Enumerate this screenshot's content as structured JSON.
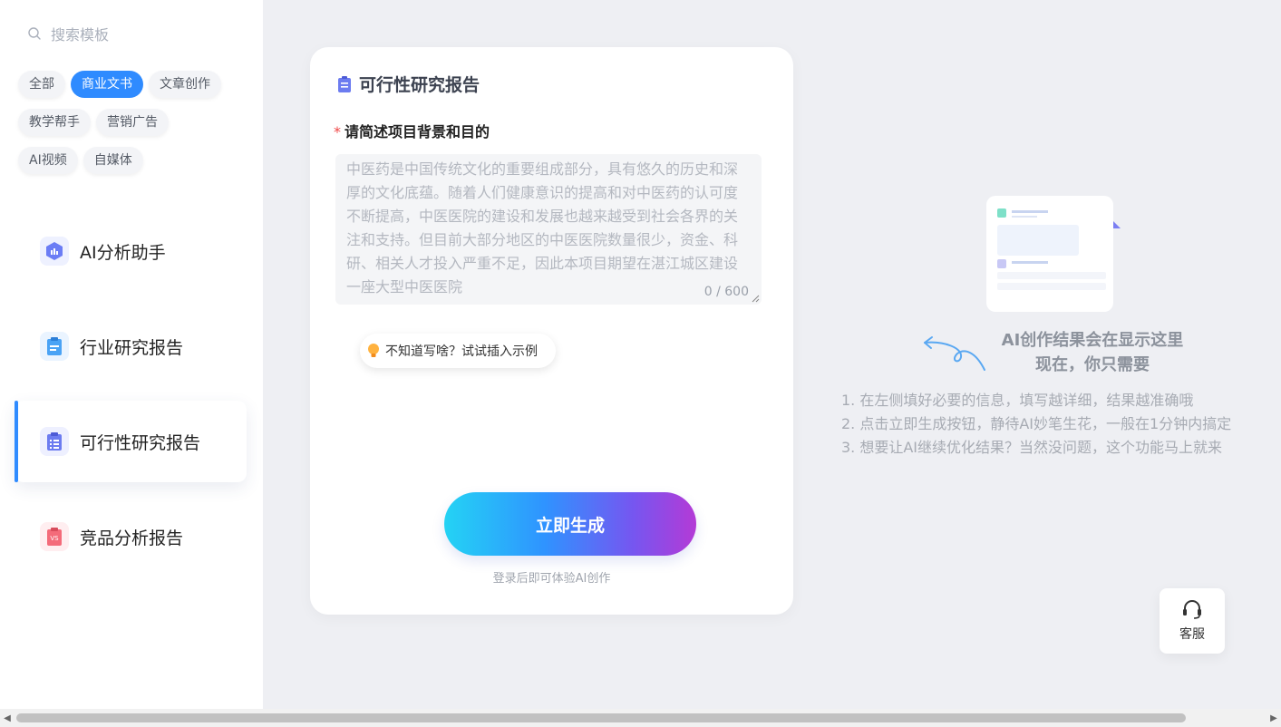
{
  "search": {
    "placeholder": "搜索模板",
    "icon": "search-icon"
  },
  "categories": {
    "rows": [
      [
        {
          "label": "全部",
          "active": false
        },
        {
          "label": "商业文书",
          "active": true
        },
        {
          "label": "文章创作",
          "active": false
        }
      ],
      [
        {
          "label": "教学帮手",
          "active": false
        },
        {
          "label": "营销广告",
          "active": false
        }
      ],
      [
        {
          "label": "AI视频",
          "active": false
        },
        {
          "label": "自媒体",
          "active": false
        }
      ]
    ]
  },
  "menu": {
    "items": [
      {
        "label": "AI分析助手",
        "icon": "chart-hexagon-icon",
        "active": false
      },
      {
        "label": "行业研究报告",
        "icon": "clipboard-icon",
        "active": false
      },
      {
        "label": "可行性研究报告",
        "icon": "clipboard-list-icon",
        "active": true
      },
      {
        "label": "竞品分析报告",
        "icon": "vs-clipboard-icon",
        "active": false
      }
    ]
  },
  "form": {
    "title": "可行性研究报告",
    "field_label": "请简述项目背景和目的",
    "required_mark": "*",
    "placeholder": "中医药是中国传统文化的重要组成部分，具有悠久的历史和深厚的文化底蕴。随着人们健康意识的提高和对中医药的认可度不断提高，中医医院的建设和发展也越来越受到社会各界的关注和支持。但目前大部分地区的中医医院数量很少，资金、科研、相关人才投入严重不足，因此本项目期望在湛江城区建设一座大型中医医院",
    "value": "",
    "counter": "0 / 600",
    "hint": "不知道写啥？试试插入示例",
    "generate_label": "立即生成",
    "login_tip": "登录后即可体验AI创作"
  },
  "result": {
    "title_line1": "AI创作结果会在显示这里",
    "title_line2": "现在，你只需要",
    "steps": [
      "1. 在左侧填好必要的信息，填写越详细，结果越准确哦",
      "2. 点击立即生成按钮，静待AI妙笔生花，一般在1分钟内搞定",
      "3. 想要让AI继续优化结果？当然没问题，这个功能马上就来"
    ]
  },
  "service": {
    "label": "客服",
    "icon": "headset-icon"
  },
  "colors": {
    "accent": "#2f8bff",
    "required": "#f04848"
  }
}
